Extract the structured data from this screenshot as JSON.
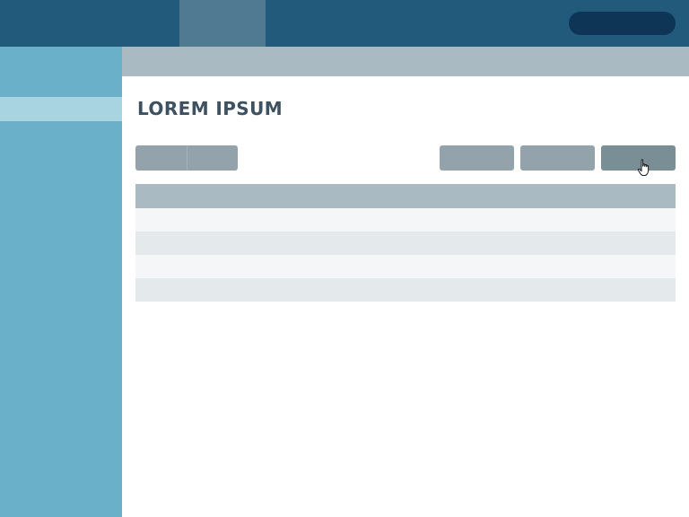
{
  "page": {
    "title": "LOREM IPSUM"
  },
  "table": {
    "row_count": 4
  },
  "icons": {
    "cursor": "hand-pointer-icon"
  },
  "colors": {
    "topbar": "#225a7b",
    "topbar_active_tab": "#4f7a91",
    "topbar_pill": "#0e3556",
    "sidebar": "#6ab0c9",
    "sidebar_active_item": "#a8d3e0",
    "content_strip": "#a9bac3",
    "button": "#94a3ab",
    "button_hover": "#7a8e96",
    "title_text": "#3d5160"
  }
}
